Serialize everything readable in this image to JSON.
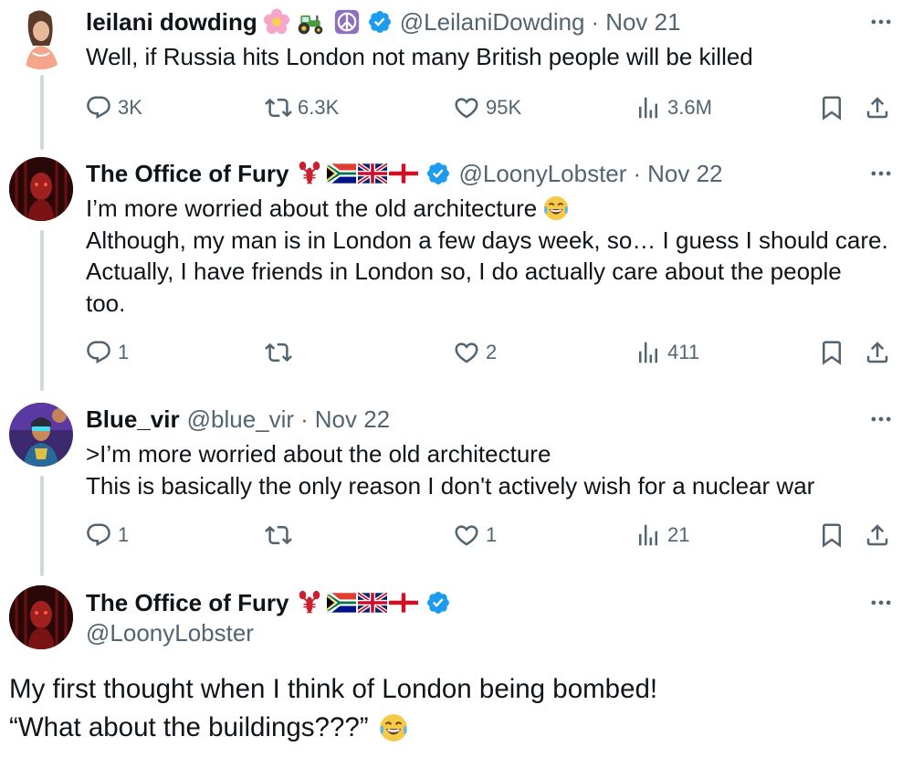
{
  "tweets": [
    {
      "name": "leilani dowding",
      "handle": "@LeilaniDowding",
      "sep": "·",
      "date": "Nov 21",
      "lines": [
        "Well, if Russia hits London not many British people will be killed"
      ],
      "replies": "3K",
      "retweets": "6.3K",
      "likes": "95K",
      "views": "3.6M"
    },
    {
      "name": "The Office of Fury",
      "handle": "@LoonyLobster",
      "sep": "·",
      "date": "Nov 22",
      "lines": [
        "I’m more worried about the old architecture",
        "Although, my man is in London a few days week, so… I guess I should care.",
        "Actually, I have friends in London so, I do actually care about the people",
        "too."
      ],
      "replies": "1",
      "retweets": "",
      "likes": "2",
      "views": "411"
    },
    {
      "name": "Blue_vir",
      "handle": "@blue_vir",
      "sep": "·",
      "date": "Nov 22",
      "lines": [
        ">I’m more worried about the old architecture",
        "This is basically the only reason I don't actively wish for a nuclear war"
      ],
      "replies": "1",
      "retweets": "",
      "likes": "1",
      "views": "21"
    }
  ],
  "main": {
    "name": "The Office of Fury",
    "handle": "@LoonyLobster",
    "lines": [
      "My first thought when I think of London being bombed!",
      "“What about the buildings???”"
    ]
  },
  "icons": {
    "reply": "reply-icon",
    "retweet": "retweet-icon",
    "like": "heart-icon",
    "views": "views-icon",
    "bookmark": "bookmark-icon",
    "share": "share-icon",
    "more": "more-icon",
    "verified": "verified-badge-icon"
  },
  "colors": {
    "verified": "#1d9bf0",
    "secondary_text": "#536471",
    "thread_line": "#cfd9de"
  }
}
